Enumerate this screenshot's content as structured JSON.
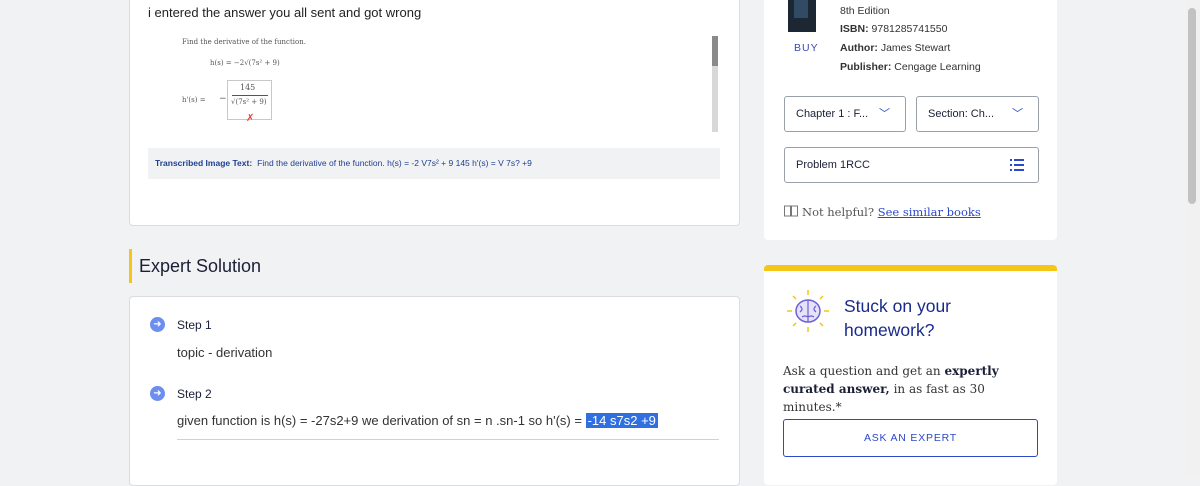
{
  "question": {
    "text": "i entered the answer you all sent and got wrong",
    "image": {
      "prompt": "Find the derivative of the function.",
      "function": "h(s) = −2√(7s² + 9)",
      "answer_label": "h'(s) =",
      "answer_numerator": "145",
      "answer_denominator": "√(7s² + 9)",
      "minus": "−",
      "wrong_mark": "✗"
    },
    "ocr_label": "Transcribed Image Text:",
    "ocr_text": "Find the derivative of the function. h(s) = -2 V7s² + 9 145 h'(s) = V 7s? +9"
  },
  "solution": {
    "heading": "Expert Solution",
    "steps": [
      {
        "label": "Step 1",
        "body": "topic  -  derivation",
        "icon": "arrow-right-icon"
      },
      {
        "label": "Step 2",
        "body_prefix": "given function is  h(s)  =  -27s2+9   we derivation of sn  =  n .sn-1  so   h'(s)   = ",
        "body_highlight": "-14 s7s2 +9",
        "icon": "arrow-right-icon"
      }
    ]
  },
  "book": {
    "edition": "8th Edition",
    "isbn_label": "ISBN:",
    "isbn": "9781285741550",
    "author_label": "Author:",
    "author": "James Stewart",
    "publisher_label": "Publisher:",
    "publisher": "Cengage Learning",
    "buy_label": "BUY",
    "chapter_select": "Chapter 1 : F...",
    "section_select": "Section: Ch...",
    "problem_select": "Problem 1RCC",
    "list_icon": "list-icon",
    "not_helpful_text": "Not helpful?",
    "see_similar_link": "See similar books"
  },
  "stuck": {
    "title": "Stuck on your homework?",
    "desc_prefix": "Ask a question and get an",
    "desc_bold": "expertly curated answer,",
    "desc_suffix": "in as fast as 30 minutes.*",
    "button": "ASK AN EXPERT",
    "icon": "brain-icon"
  },
  "colors": {
    "accent": "#2b49c9",
    "highlight": "#f5c518",
    "step_icon": "#6b8ef0"
  }
}
